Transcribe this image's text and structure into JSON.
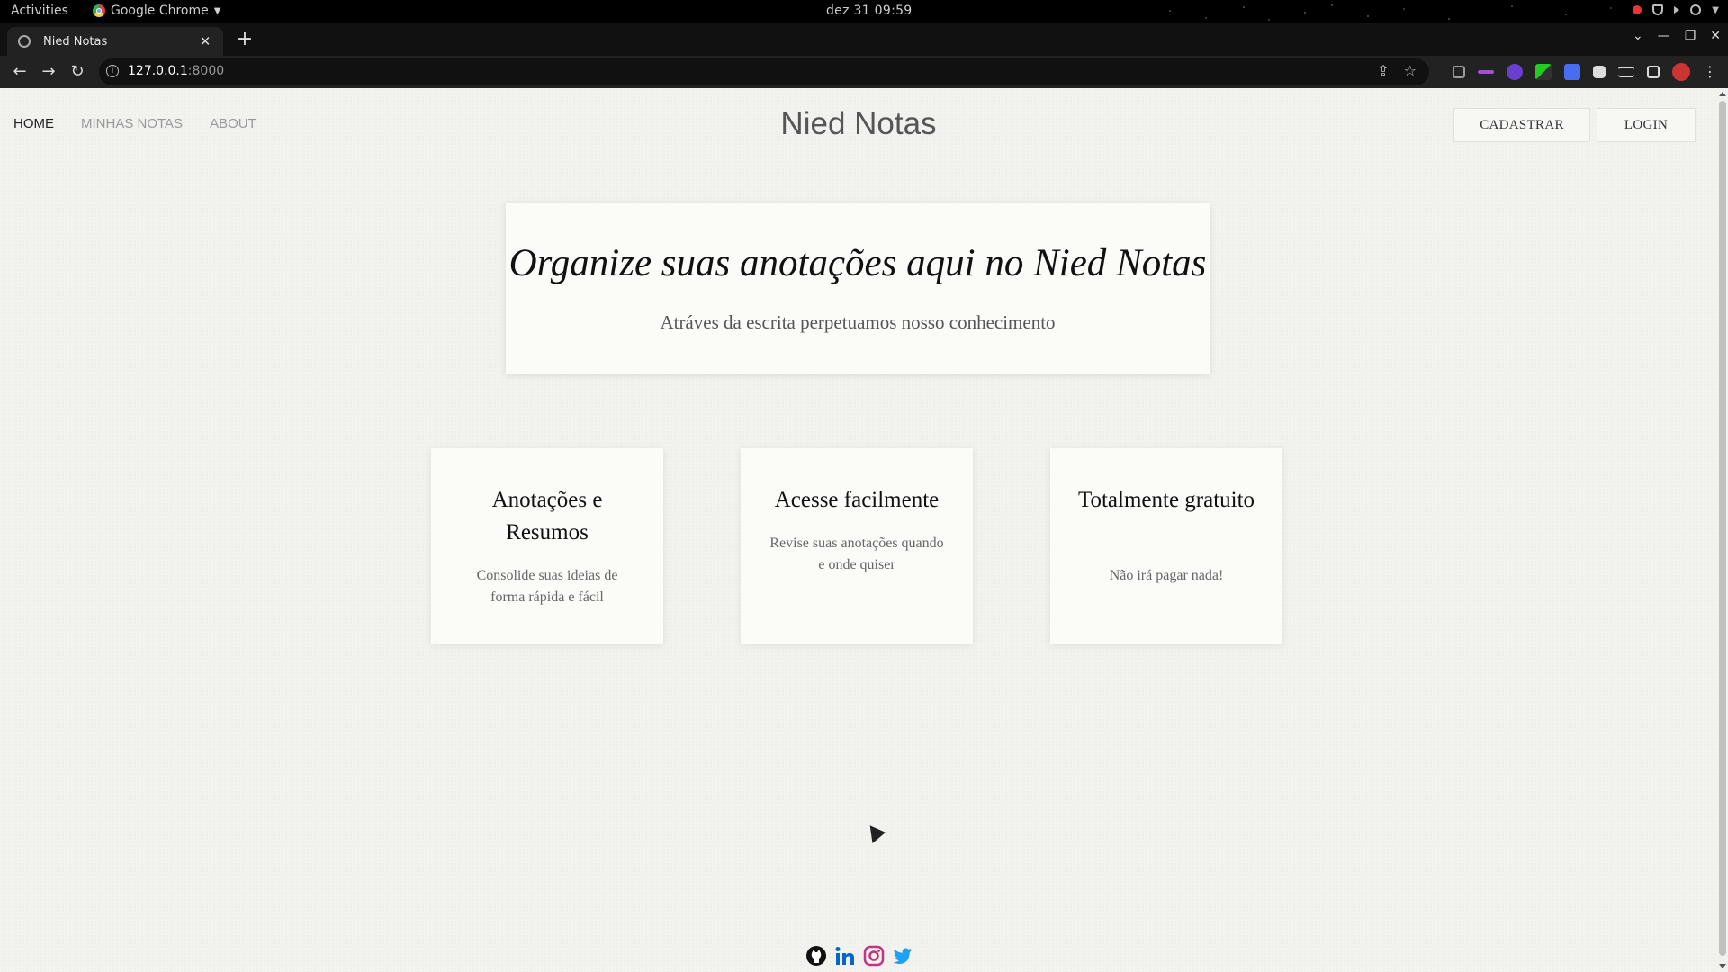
{
  "os": {
    "activities": "Activities",
    "app_name": "Google Chrome",
    "clock": "dez 31  09:59"
  },
  "browser": {
    "tab_title": "Nied Notas",
    "url_host": "127.0.0.1",
    "url_port": ":8000"
  },
  "nav": {
    "links": [
      "HOME",
      "MINHAS NOTAS",
      "ABOUT"
    ],
    "brand": "Nied Notas",
    "signup_label": "CADASTRAR",
    "login_label": "LOGIN"
  },
  "hero": {
    "title": "Organize suas anotações aqui no Nied Notas",
    "subtitle": "Atráves da escrita perpetuamos nosso conhecimento"
  },
  "cards": [
    {
      "title": "Anotações e Resumos",
      "text": "Consolide suas ideias de forma rápida e fácil"
    },
    {
      "title": "Acesse facilmente",
      "text": "Revise suas anotações quando e onde quiser"
    },
    {
      "title": "Totalmente gratuito",
      "text": "Não irá pagar nada!"
    }
  ],
  "footer": {
    "social_icons": [
      "github-icon",
      "linkedin-icon",
      "instagram-icon",
      "twitter-icon"
    ],
    "colors": {
      "github": "#111111",
      "linkedin": "#0a66c2",
      "instagram": "#c13584",
      "twitter": "#1da1f2"
    }
  }
}
